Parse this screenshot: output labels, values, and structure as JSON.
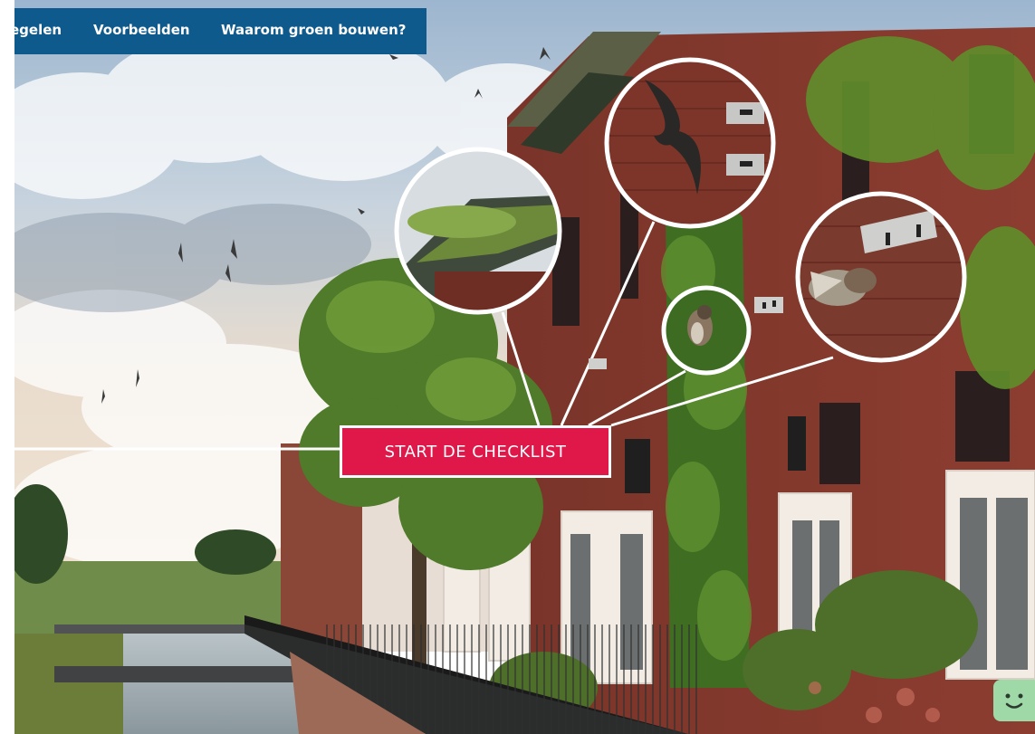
{
  "nav": {
    "items": [
      {
        "label": "egelen"
      },
      {
        "label": "Voorbeelden"
      },
      {
        "label": "Waarom groen bouwen?"
      }
    ]
  },
  "hero": {
    "cta_label": "START DE CHECKLIST",
    "image_description_icon": "green-building-photo"
  },
  "colors": {
    "nav_bg": "#0f5a8d",
    "cta_bg": "#e0184a",
    "chat_bg": "#9fd9a8"
  },
  "chat": {
    "icon": "smiley-chat-icon"
  }
}
